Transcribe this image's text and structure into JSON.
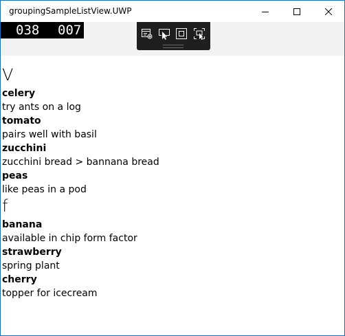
{
  "window": {
    "title": "groupingSampleListView.UWP"
  },
  "counter": {
    "left": "038",
    "right": "007"
  },
  "groups": [
    {
      "header": "V",
      "items": [
        {
          "name": "celery",
          "description": "try ants on a log"
        },
        {
          "name": "tomato",
          "description": "pairs well with basil"
        },
        {
          "name": "zucchini",
          "description": "zucchini bread > bannana bread"
        },
        {
          "name": "peas",
          "description": "like peas in a pod"
        }
      ]
    },
    {
      "header": "f",
      "items": [
        {
          "name": "banana",
          "description": "available in chip form factor"
        },
        {
          "name": "strawberry",
          "description": "spring plant"
        },
        {
          "name": "cherry",
          "description": "topper for icecream"
        }
      ]
    }
  ]
}
